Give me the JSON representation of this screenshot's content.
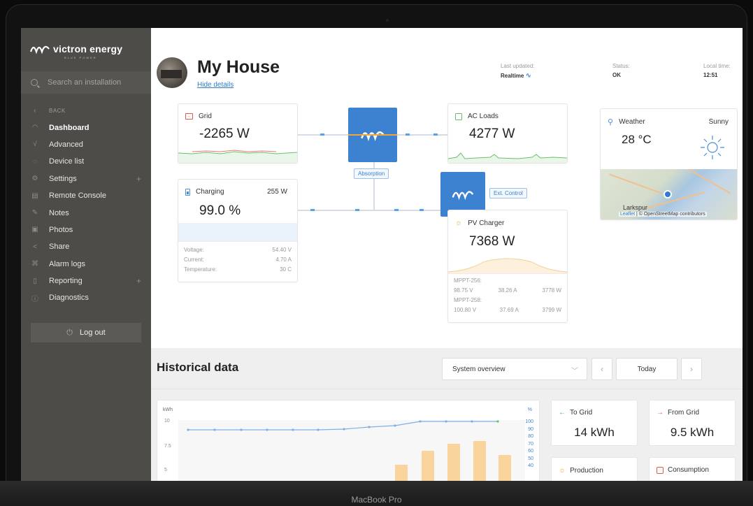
{
  "device_label": "MacBook Pro",
  "sidebar": {
    "brand": "victron energy",
    "brand_sub": "BLUE POWER",
    "search_placeholder": "Search an installation",
    "back": "BACK",
    "items": [
      {
        "label": "Dashboard",
        "icon": "gauge-icon",
        "active": true
      },
      {
        "label": "Advanced",
        "icon": "chart-icon"
      },
      {
        "label": "Device list",
        "icon": "location-icon"
      },
      {
        "label": "Settings",
        "icon": "gear-icon",
        "expandable": true
      },
      {
        "label": "Remote Console",
        "icon": "console-icon"
      },
      {
        "label": "Notes",
        "icon": "edit-icon"
      },
      {
        "label": "Photos",
        "icon": "image-icon"
      },
      {
        "label": "Share",
        "icon": "share-icon"
      },
      {
        "label": "Alarm logs",
        "icon": "alarm-icon"
      },
      {
        "label": "Reporting",
        "icon": "report-icon",
        "expandable": true
      },
      {
        "label": "Diagnostics",
        "icon": "info-icon"
      }
    ],
    "logout": "Log out"
  },
  "header": {
    "title": "My House",
    "hide_details": "Hide details",
    "last_updated_label": "Last updated:",
    "last_updated_value": "Realtime",
    "status_label": "Status:",
    "status_value": "OK",
    "local_time_label": "Local time:",
    "local_time_value": "12:51"
  },
  "grid": {
    "label": "Grid",
    "value": "-2265 W"
  },
  "battery": {
    "label": "Charging",
    "power": "255 W",
    "soc": "99.0 %",
    "voltage_label": "Voltage:",
    "voltage": "54.40 V",
    "current_label": "Current:",
    "current": "4.70 A",
    "temp_label": "Temperature:",
    "temp": "30 C"
  },
  "inverter_state": "Absorption",
  "ac_loads": {
    "label": "AC Loads",
    "value": "4277 W"
  },
  "mppt": {
    "tag": "Ext. Control"
  },
  "pv": {
    "label": "PV Charger",
    "value": "7368 W",
    "rows": [
      {
        "name": "MPPT-256:",
        "v": "98.75 V",
        "a": "38.26 A",
        "w": "3778 W"
      },
      {
        "name": "MPPT-258:",
        "v": "100.80 V",
        "a": "37.69 A",
        "w": "3799 W"
      }
    ]
  },
  "weather": {
    "label": "Weather",
    "condition": "Sunny",
    "temp": "28 °C",
    "map_place": "Larkspur",
    "map_attr_leaflet": "Leaflet",
    "map_attr_rest": " | © OpenStreetMap contributors"
  },
  "history": {
    "title": "Historical data",
    "select": "System overview",
    "today": "Today",
    "chart_left_unit": "kWh",
    "chart_right_unit": "%",
    "left_ticks": [
      "10",
      "7.5",
      "5"
    ],
    "right_ticks": [
      "100",
      "90",
      "80",
      "70",
      "60",
      "50",
      "40"
    ],
    "to_grid_label": "To Grid",
    "to_grid": "14 kWh",
    "from_grid_label": "From Grid",
    "from_grid": "9.5 kWh",
    "production_label": "Production",
    "consumption_label": "Consumption"
  },
  "colors": {
    "accent": "#3c82d0",
    "sidebar": "#4d4c48",
    "sun": "#f0a637",
    "grid": "#e05a4a"
  }
}
